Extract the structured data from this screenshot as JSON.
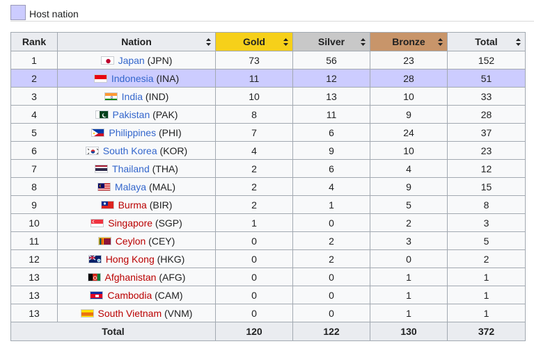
{
  "legend": {
    "label": "Host nation",
    "color": "#ccccff"
  },
  "headers": {
    "rank": "Rank",
    "nation": "Nation",
    "gold": "Gold",
    "silver": "Silver",
    "bronze": "Bronze",
    "total": "Total"
  },
  "rows": [
    {
      "rank": "1",
      "country": "Japan",
      "code": "(JPN)",
      "gold": "73",
      "silver": "56",
      "bronze": "23",
      "total": "152",
      "flag": "japan-flag-icon"
    },
    {
      "rank": "2",
      "country": "Indonesia",
      "code": "(INA)",
      "gold": "11",
      "silver": "12",
      "bronze": "28",
      "total": "51",
      "flag": "indonesia-flag-icon",
      "host": true
    },
    {
      "rank": "3",
      "country": "India",
      "code": "(IND)",
      "gold": "10",
      "silver": "13",
      "bronze": "10",
      "total": "33",
      "flag": "india-flag-icon"
    },
    {
      "rank": "4",
      "country": "Pakistan",
      "code": "(PAK)",
      "gold": "8",
      "silver": "11",
      "bronze": "9",
      "total": "28",
      "flag": "pakistan-flag-icon"
    },
    {
      "rank": "5",
      "country": "Philippines",
      "code": "(PHI)",
      "gold": "7",
      "silver": "6",
      "bronze": "24",
      "total": "37",
      "flag": "philippines-flag-icon"
    },
    {
      "rank": "6",
      "country": "South Korea",
      "code": "(KOR)",
      "gold": "4",
      "silver": "9",
      "bronze": "10",
      "total": "23",
      "flag": "south-korea-flag-icon"
    },
    {
      "rank": "7",
      "country": "Thailand",
      "code": "(THA)",
      "gold": "2",
      "silver": "6",
      "bronze": "4",
      "total": "12",
      "flag": "thailand-flag-icon"
    },
    {
      "rank": "8",
      "country": "Malaya",
      "code": "(MAL)",
      "gold": "2",
      "silver": "4",
      "bronze": "9",
      "total": "15",
      "flag": "malaya-flag-icon"
    },
    {
      "rank": "9",
      "country": "Burma",
      "code": "(BIR)",
      "gold": "2",
      "silver": "1",
      "bronze": "5",
      "total": "8",
      "flag": "burma-flag-icon"
    },
    {
      "rank": "10",
      "country": "Singapore",
      "code": "(SGP)",
      "gold": "1",
      "silver": "0",
      "bronze": "2",
      "total": "3",
      "flag": "singapore-flag-icon"
    },
    {
      "rank": "11",
      "country": "Ceylon",
      "code": "(CEY)",
      "gold": "0",
      "silver": "2",
      "bronze": "3",
      "total": "5",
      "flag": "ceylon-flag-icon"
    },
    {
      "rank": "12",
      "country": "Hong Kong",
      "code": "(HKG)",
      "gold": "0",
      "silver": "2",
      "bronze": "0",
      "total": "2",
      "flag": "hong-kong-flag-icon"
    },
    {
      "rank": "13",
      "country": "Afghanistan",
      "code": "(AFG)",
      "gold": "0",
      "silver": "0",
      "bronze": "1",
      "total": "1",
      "flag": "afghanistan-flag-icon"
    },
    {
      "rank": "13",
      "country": "Cambodia",
      "code": "(CAM)",
      "gold": "0",
      "silver": "0",
      "bronze": "1",
      "total": "1",
      "flag": "cambodia-flag-icon"
    },
    {
      "rank": "13",
      "country": "South Vietnam",
      "code": "(VNM)",
      "gold": "0",
      "silver": "0",
      "bronze": "1",
      "total": "1",
      "flag": "south-vietnam-flag-icon"
    }
  ],
  "totals": {
    "label": "Total",
    "gold": "120",
    "silver": "122",
    "bronze": "130",
    "total": "372"
  },
  "colors": {
    "gold": "#f6d01a",
    "silver": "#c8c8c8",
    "bronze": "#c8956a",
    "link": "#3366cc",
    "redlink": "#ba0000"
  }
}
